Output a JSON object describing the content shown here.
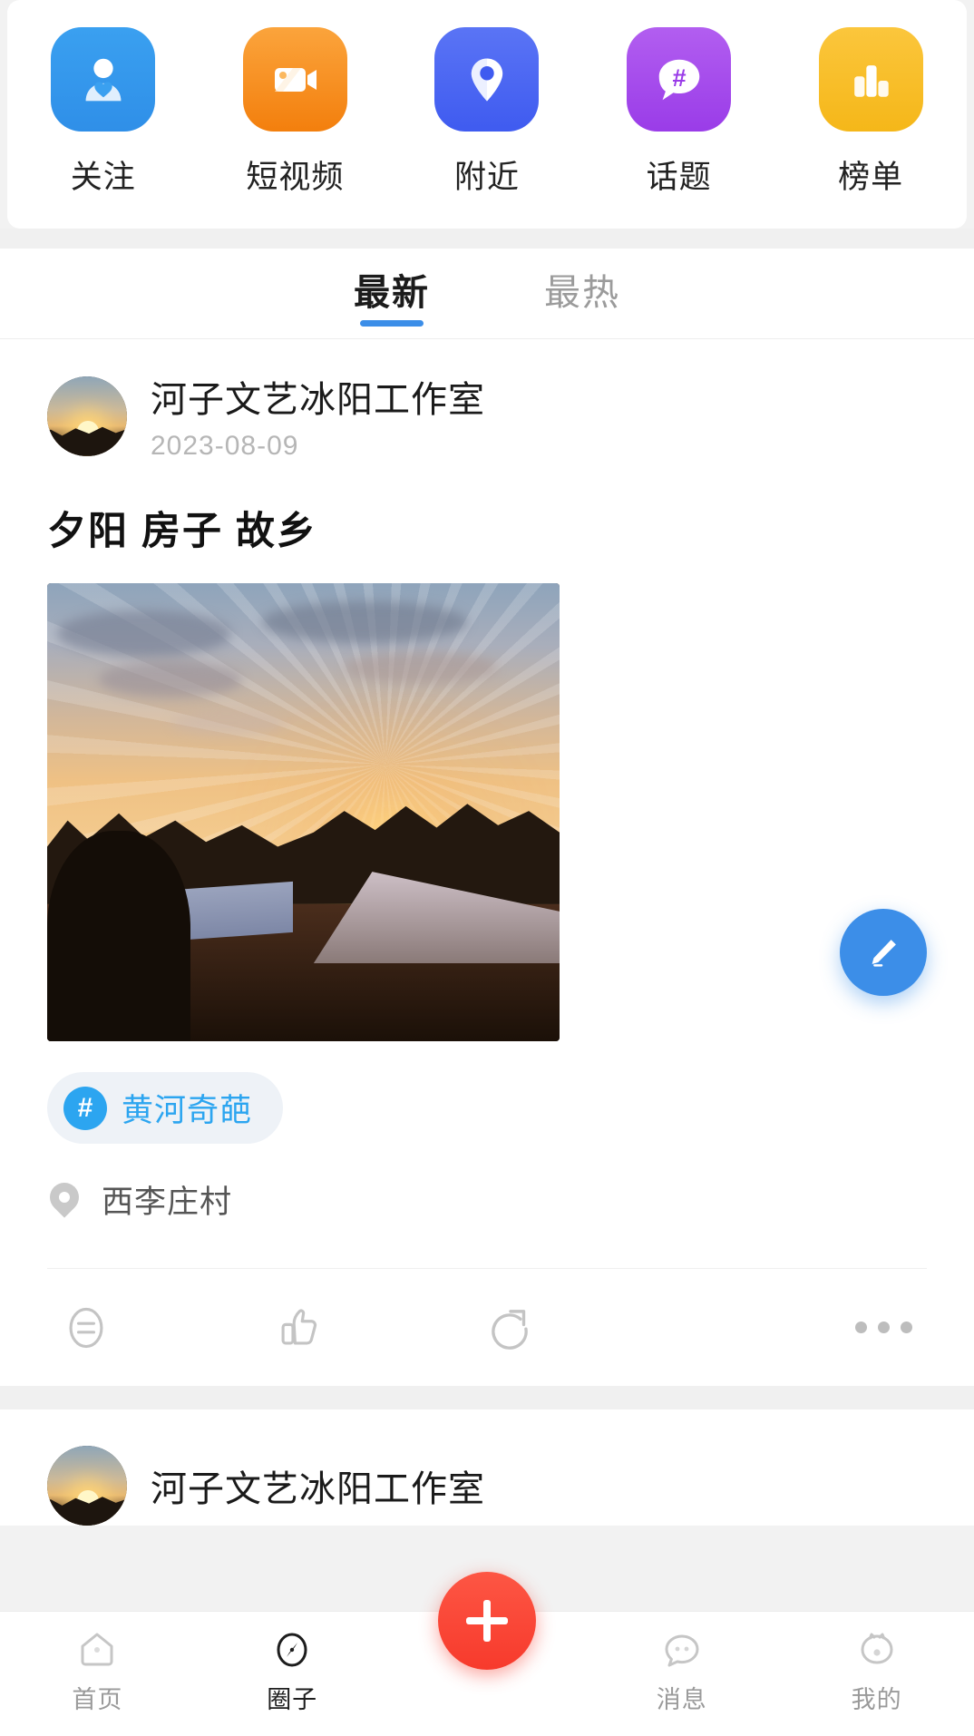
{
  "quick_entries": [
    {
      "label": "关注",
      "icon": "user-heart-icon",
      "color": "#3aa0f0",
      "color2": "#2f8fe8"
    },
    {
      "label": "短视频",
      "icon": "video-camera-icon",
      "color": "#fba43c",
      "color2": "#f37f0d"
    },
    {
      "label": "附近",
      "icon": "location-pin-icon",
      "color": "#5a74f5",
      "color2": "#3f5bf0"
    },
    {
      "label": "话题",
      "icon": "hashtag-bubble-icon",
      "color": "#b25ef0",
      "color2": "#9a3ce8"
    },
    {
      "label": "榜单",
      "icon": "bar-chart-icon",
      "color": "#fbc63c",
      "color2": "#f5b719"
    }
  ],
  "tabs": [
    {
      "label": "最新",
      "active": true
    },
    {
      "label": "最热",
      "active": false
    }
  ],
  "accent_color": "#3c8ee8",
  "post": {
    "author": "河子文艺冰阳工作室",
    "date": "2023-08-09",
    "title": "夕阳 房子 故乡",
    "hashtag": "黄河奇葩",
    "hashtag_symbol": "#",
    "location": "西李庄村",
    "actions": {
      "comment": "comment-icon",
      "like": "thumbs-up-icon",
      "share": "share-icon",
      "more": "more-dots-icon"
    }
  },
  "post2": {
    "author": "河子文艺冰阳工作室"
  },
  "compose_fab": {
    "icon": "pencil-icon",
    "color": "#3c8ee8"
  },
  "bottom_nav": {
    "add_button": {
      "icon": "plus-icon",
      "color": "#f73a2c"
    },
    "items": [
      {
        "label": "首页",
        "icon": "home-icon",
        "active": false
      },
      {
        "label": "圈子",
        "icon": "compass-icon",
        "active": true
      },
      {
        "label": "消息",
        "icon": "chat-icon",
        "active": false
      },
      {
        "label": "我的",
        "icon": "profile-icon",
        "active": false
      }
    ]
  }
}
